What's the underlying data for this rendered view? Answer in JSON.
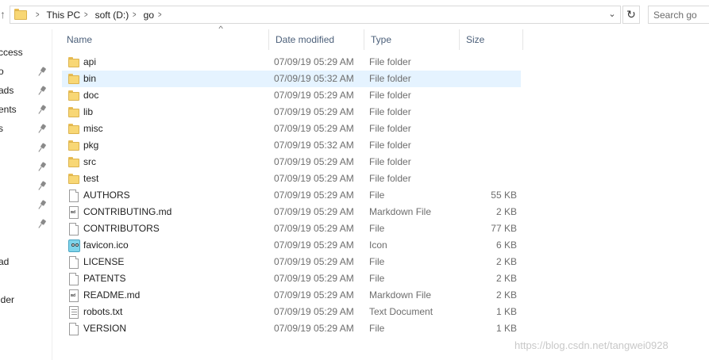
{
  "address_bar": {
    "crumbs": [
      "This PC",
      "soft (D:)",
      "go"
    ],
    "search_placeholder": "Search go"
  },
  "nav_pane": {
    "items": [
      {
        "label": "ccess",
        "pinned": false
      },
      {
        "label": "o",
        "pinned": true
      },
      {
        "label": "ads",
        "pinned": true
      },
      {
        "label": "ents",
        "pinned": true
      },
      {
        "label": "s",
        "pinned": true
      },
      {
        "label": "",
        "pinned": true
      },
      {
        "label": "",
        "pinned": true
      },
      {
        "label": "",
        "pinned": true
      },
      {
        "label": "",
        "pinned": true
      },
      {
        "label": "",
        "pinned": true
      },
      {
        "label": "ad",
        "pinned": false
      },
      {
        "label": "lder",
        "pinned": false
      },
      {
        "label": "",
        "pinned": false
      }
    ]
  },
  "columns": {
    "name": "Name",
    "date": "Date modified",
    "type": "Type",
    "size": "Size",
    "sort_indicator": "^"
  },
  "files": [
    {
      "name": "api",
      "date": "07/09/19 05:29 AM",
      "type": "File folder",
      "size": "",
      "icon": "folder-icon",
      "selected": false
    },
    {
      "name": "bin",
      "date": "07/09/19 05:32 AM",
      "type": "File folder",
      "size": "",
      "icon": "folder-icon",
      "selected": true
    },
    {
      "name": "doc",
      "date": "07/09/19 05:29 AM",
      "type": "File folder",
      "size": "",
      "icon": "folder-icon",
      "selected": false
    },
    {
      "name": "lib",
      "date": "07/09/19 05:29 AM",
      "type": "File folder",
      "size": "",
      "icon": "folder-icon",
      "selected": false
    },
    {
      "name": "misc",
      "date": "07/09/19 05:29 AM",
      "type": "File folder",
      "size": "",
      "icon": "folder-icon",
      "selected": false
    },
    {
      "name": "pkg",
      "date": "07/09/19 05:32 AM",
      "type": "File folder",
      "size": "",
      "icon": "folder-icon",
      "selected": false
    },
    {
      "name": "src",
      "date": "07/09/19 05:29 AM",
      "type": "File folder",
      "size": "",
      "icon": "folder-icon",
      "selected": false
    },
    {
      "name": "test",
      "date": "07/09/19 05:29 AM",
      "type": "File folder",
      "size": "",
      "icon": "folder-icon",
      "selected": false
    },
    {
      "name": "AUTHORS",
      "date": "07/09/19 05:29 AM",
      "type": "File",
      "size": "55 KB",
      "icon": "file-icon",
      "selected": false
    },
    {
      "name": "CONTRIBUTING.md",
      "date": "07/09/19 05:29 AM",
      "type": "Markdown File",
      "size": "2 KB",
      "icon": "markdown-file-icon",
      "selected": false
    },
    {
      "name": "CONTRIBUTORS",
      "date": "07/09/19 05:29 AM",
      "type": "File",
      "size": "77 KB",
      "icon": "file-icon",
      "selected": false
    },
    {
      "name": "favicon.ico",
      "date": "07/09/19 05:29 AM",
      "type": "Icon",
      "size": "6 KB",
      "icon": "gopher-image-icon",
      "selected": false
    },
    {
      "name": "LICENSE",
      "date": "07/09/19 05:29 AM",
      "type": "File",
      "size": "2 KB",
      "icon": "file-icon",
      "selected": false
    },
    {
      "name": "PATENTS",
      "date": "07/09/19 05:29 AM",
      "type": "File",
      "size": "2 KB",
      "icon": "file-icon",
      "selected": false
    },
    {
      "name": "README.md",
      "date": "07/09/19 05:29 AM",
      "type": "Markdown File",
      "size": "2 KB",
      "icon": "markdown-file-icon",
      "selected": false
    },
    {
      "name": "robots.txt",
      "date": "07/09/19 05:29 AM",
      "type": "Text Document",
      "size": "1 KB",
      "icon": "text-document-icon",
      "selected": false
    },
    {
      "name": "VERSION",
      "date": "07/09/19 05:29 AM",
      "type": "File",
      "size": "1 KB",
      "icon": "file-icon",
      "selected": false
    }
  ],
  "watermark": "https://blog.csdn.net/tangwei0928"
}
